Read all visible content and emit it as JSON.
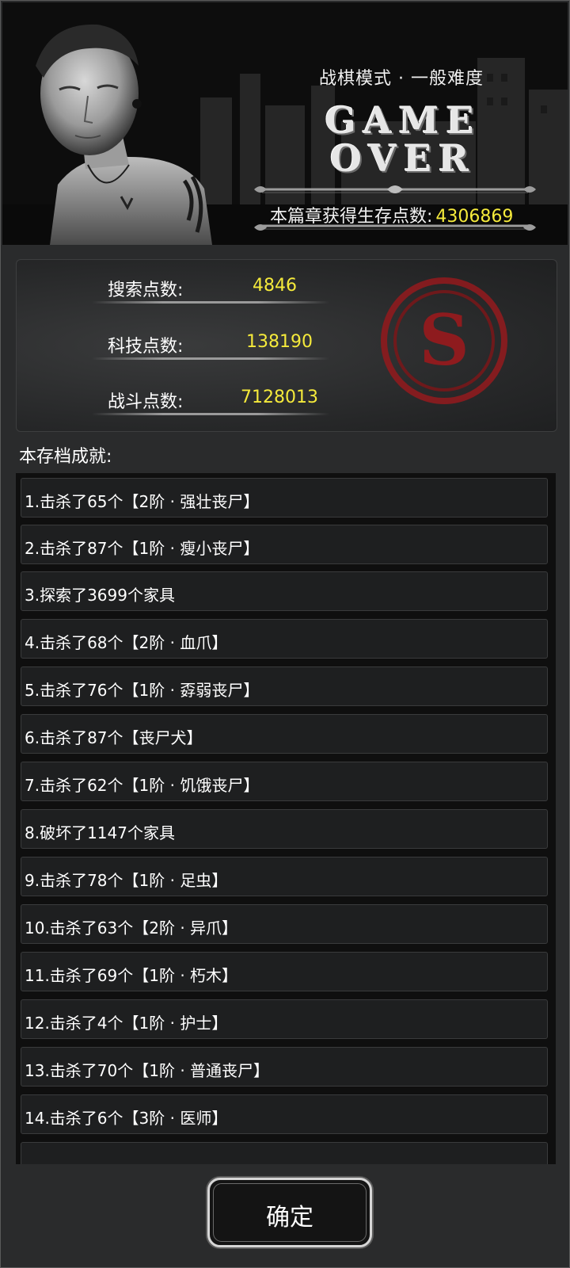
{
  "header": {
    "mode_text": "战棋模式 · 一般难度",
    "game_over_line1": "GAME",
    "game_over_line2": "OVER",
    "points_label": "本篇章获得生存点数:",
    "points_value": "4306869"
  },
  "stats": {
    "search": {
      "label": "搜索点数:",
      "value": "4846"
    },
    "tech": {
      "label": "科技点数:",
      "value": "138190"
    },
    "combat": {
      "label": "战斗点数:",
      "value": "7128013"
    },
    "seal_letter": "S"
  },
  "achievements": {
    "title": "本存档成就:",
    "items": [
      "1.击杀了65个【2阶 · 强壮丧尸】",
      "2.击杀了87个【1阶 · 瘦小丧尸】",
      "3.探索了3699个家具",
      "4.击杀了68个【2阶 · 血爪】",
      "5.击杀了76个【1阶 · 孬弱丧尸】",
      "6.击杀了87个【丧尸犬】",
      "7.击杀了62个【1阶 · 饥饿丧尸】",
      "8.破坏了1147个家具",
      "9.击杀了78个【1阶 · 足虫】",
      "10.击杀了63个【2阶 · 异爪】",
      "11.击杀了69个【1阶 · 朽木】",
      "12.击杀了4个【1阶 · 护士】",
      "13.击杀了70个【1阶 · 普通丧尸】",
      "14.击杀了6个【3阶 · 医师】"
    ]
  },
  "confirm_label": "确定",
  "colors": {
    "highlight": "#f5ea3b",
    "seal_red": "#8e1b1e",
    "background": "#2a2b2c"
  }
}
